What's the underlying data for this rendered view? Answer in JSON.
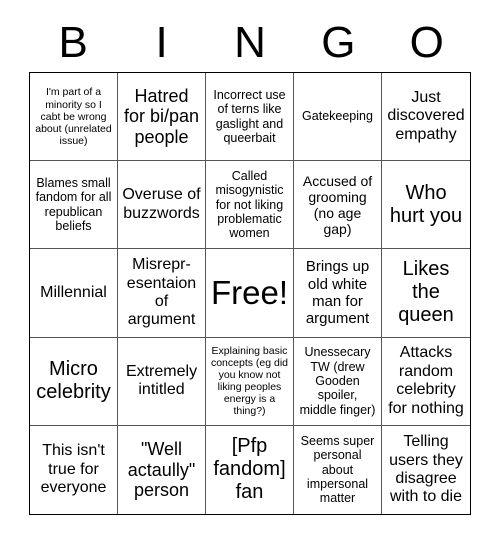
{
  "header": {
    "letters": [
      "B",
      "I",
      "N",
      "G",
      "O"
    ]
  },
  "cells": [
    "I'm part of a minority so I cabt be wrong about (unrelated issue)",
    "Hatred for bi/pan people",
    "Incorrect use of terns like gaslight and queerbait",
    "Gatekeeping",
    "Just discovered empathy",
    "Blames small fandom for all republican beliefs",
    "Overuse of buzzwords",
    "Called misogynistic for not liking problematic women",
    "Accused of grooming (no age gap)",
    "Who hurt you",
    "Millennial",
    "Misrepr- esentaion of argument",
    "Free!",
    "Brings up old white man for argument",
    "Likes the queen",
    "Micro celebrity",
    "Extremely intitled",
    "Explaining basic concepts (eg did you know not liking peoples energy is a thing?)",
    "Unessecary TW (drew Gooden spoiler, middle finger)",
    "Attacks random celebrity for nothing",
    "This isn't true for everyone",
    "\"Well actaully\" person",
    "[Pfp fandom] fan",
    "Seems super personal about impersonal matter",
    "Telling users they disagree with to die"
  ]
}
